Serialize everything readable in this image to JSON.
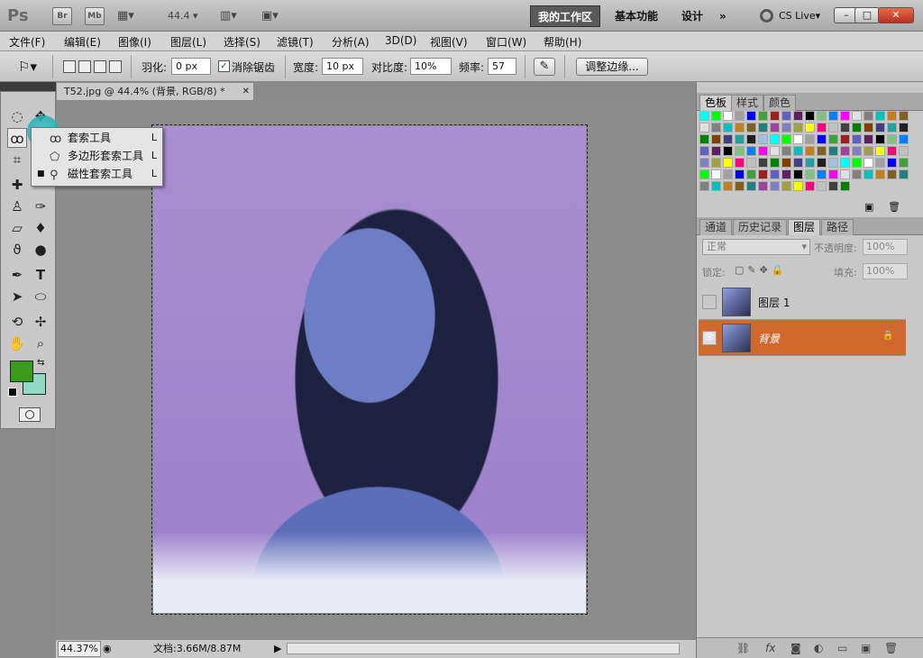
{
  "app": {
    "logo": "Ps",
    "br": "Br",
    "mb": "Mb",
    "zoom_dropdown": "44.4"
  },
  "workspaces": {
    "mine": "我的工作区",
    "essentials": "基本功能",
    "design": "设计",
    "more": "»",
    "cslive": "CS Live"
  },
  "menu": [
    "文件(F)",
    "编辑(E)",
    "图像(I)",
    "图层(L)",
    "选择(S)",
    "滤镜(T)",
    "分析(A)",
    "3D(D)",
    "视图(V)",
    "窗口(W)",
    "帮助(H)"
  ],
  "options": {
    "feather_label": "羽化:",
    "feather_value": "0 px",
    "antialias_label": "消除锯齿",
    "width_label": "宽度:",
    "width_value": "10 px",
    "contrast_label": "对比度:",
    "contrast_value": "10%",
    "frequency_label": "频率:",
    "frequency_value": "57",
    "refine_edge": "调整边缘..."
  },
  "document": {
    "tab_title": "T52.jpg @ 44.4% (背景, RGB/8) *",
    "close": "✕"
  },
  "flyout": [
    {
      "label": "套索工具",
      "key": "L"
    },
    {
      "label": "多边形套索工具",
      "key": "L"
    },
    {
      "label": "磁性套索工具",
      "key": "L"
    }
  ],
  "status": {
    "zoom": "44.37%",
    "doc": "文档:3.66M/8.87M"
  },
  "colors": {
    "foreground": "#3a9a1a",
    "background": "#8fd8c4",
    "accent": "#d0692b"
  },
  "swatch_panel": {
    "tabs": [
      "色板",
      "样式",
      "颜色"
    ]
  },
  "layers_panel": {
    "tabs": [
      "通道",
      "历史记录",
      "图层",
      "路径"
    ],
    "blend_mode": "正常",
    "opacity_label": "不透明度:",
    "opacity_value": "100%",
    "lock_label": "锁定:",
    "fill_label": "填充:",
    "fill_value": "100%",
    "layers": [
      {
        "name": "图层 1"
      },
      {
        "name": "背景"
      }
    ]
  }
}
